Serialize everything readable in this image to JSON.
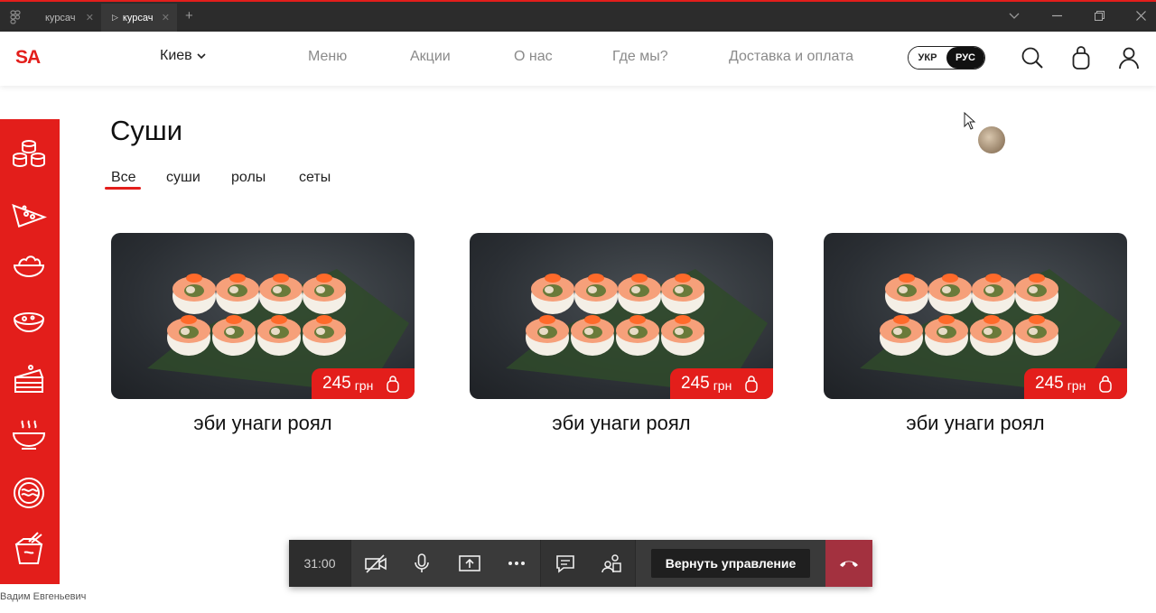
{
  "browser": {
    "tabs": [
      {
        "label": "курсач",
        "active": false
      },
      {
        "label": "курсач",
        "active": true
      }
    ],
    "new_tab_symbol": "+",
    "close_symbol": "✕",
    "play_symbol": "▷"
  },
  "header": {
    "logo": "SA",
    "city": "Киев",
    "nav": [
      "Меню",
      "Акции",
      "О нас",
      "Где мы?",
      "Доставка и оплата"
    ],
    "languages": [
      {
        "label": "УКР",
        "active": false
      },
      {
        "label": "РУС",
        "active": true
      }
    ],
    "icons": [
      "search-icon",
      "cart-icon",
      "user-icon"
    ],
    "accent": "#e31e1b"
  },
  "sidebar": {
    "icons": [
      "sushi-icon",
      "pizza-icon",
      "salad-icon",
      "soup-icon",
      "cake-icon",
      "hot-bowl-icon",
      "noodles-icon",
      "wok-box-icon"
    ]
  },
  "main": {
    "title": "Суши",
    "categories": [
      {
        "label": "Все",
        "active": true
      },
      {
        "label": "суши",
        "active": false
      },
      {
        "label": "ролы",
        "active": false
      },
      {
        "label": "сеты",
        "active": false
      }
    ],
    "products": [
      {
        "name": "эби унаги роял",
        "price": "245",
        "currency": "грн"
      },
      {
        "name": "эби унаги роял",
        "price": "245",
        "currency": "грн"
      },
      {
        "name": "эби унаги роял",
        "price": "245",
        "currency": "грн"
      }
    ]
  },
  "callbar": {
    "timer": "31:00",
    "return_control": "Вернуть управление",
    "icons": [
      "camera-off-icon",
      "microphone-icon",
      "share-screen-icon",
      "more-icon",
      "chat-icon",
      "participants-icon",
      "hang-up-icon"
    ]
  },
  "presenter_name": "Вадим Евгеньевич"
}
